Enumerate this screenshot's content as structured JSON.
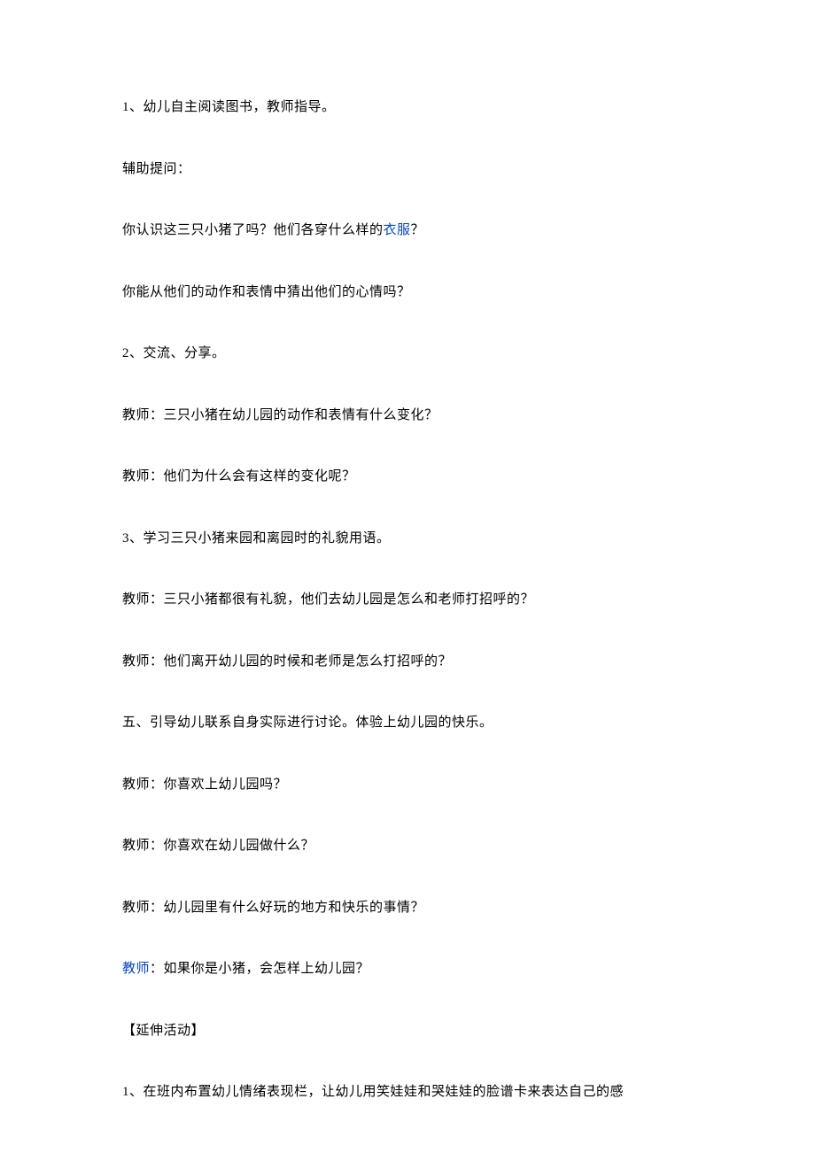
{
  "paragraphs": {
    "p1": "1、幼儿自主阅读图书，教师指导。",
    "p2": "辅助提问：",
    "p3_prefix": "你认识这三只小猪了吗？他们各穿什么样的",
    "p3_link": "衣服",
    "p3_suffix": "？",
    "p4": "你能从他们的动作和表情中猜出他们的心情吗？",
    "p5": "2、交流、分享。",
    "p6": "教师：三只小猪在幼儿园的动作和表情有什么变化？",
    "p7": "教师：他们为什么会有这样的变化呢？",
    "p8": "3、学习三只小猪来园和离园时的礼貌用语。",
    "p9": "教师：三只小猪都很有礼貌，他们去幼儿园是怎么和老师打招呼的？",
    "p10": "教师：他们离开幼儿园的时候和老师是怎么打招呼的？",
    "p11": "五、引导幼儿联系自身实际进行讨论。体验上幼儿园的快乐。",
    "p12": "教师：你喜欢上幼儿园吗？",
    "p13": "教师：你喜欢在幼儿园做什么？",
    "p14": "教师：幼儿园里有什么好玩的地方和快乐的事情？",
    "p15_link": "教师",
    "p15_suffix": "：如果你是小猪，会怎样上幼儿园？",
    "p16": "【延伸活动】",
    "p17": "1、在班内布置幼儿情绪表现栏，让幼儿用笑娃娃和哭娃娃的脸谱卡来表达自己的感"
  }
}
